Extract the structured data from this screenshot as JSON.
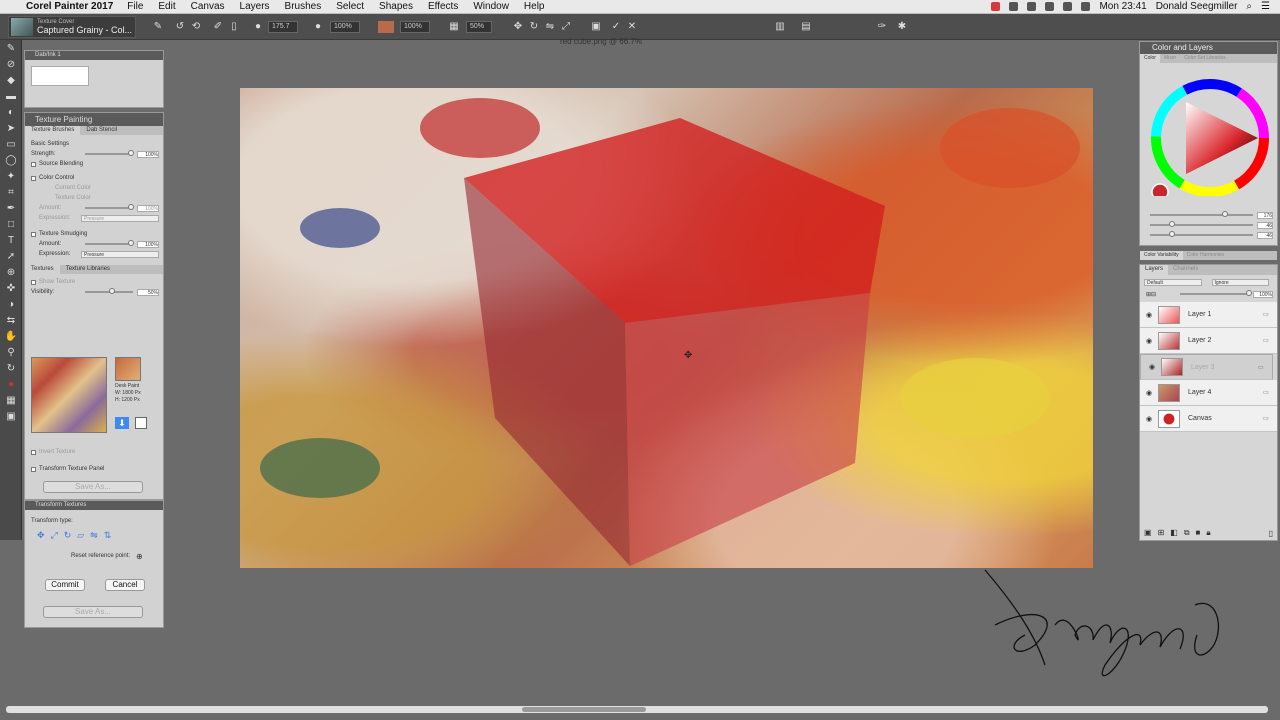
{
  "menubar": {
    "app_name": "Corel Painter 2017",
    "items": [
      "File",
      "Edit",
      "Canvas",
      "Layers",
      "Brushes",
      "Select",
      "Shapes",
      "Effects",
      "Window",
      "Help"
    ],
    "clock": "Mon 23:41",
    "user": "Donald Seegmiller"
  },
  "propbar": {
    "brush_category": "Texture Cover",
    "brush_variant": "Captured Grainy - Col...",
    "size_value": "175.7",
    "opacity_value": "100%",
    "grain_value": "100%",
    "extra_value": "50%"
  },
  "canvas": {
    "title": "red cube.png @ 66.7%"
  },
  "dab_panel": {
    "title": "Dab/Ink 1"
  },
  "texture_panel": {
    "title": "Texture Painting",
    "tabs": [
      "Texture Brushes",
      "Dab Stencil"
    ],
    "basic_settings": "Basic Settings",
    "strength_label": "Strength:",
    "strength_value": "100%",
    "source_blending": "Source Blending",
    "color_control": "Color Control",
    "current_color": "Current Color",
    "texture_color": "Texture Color",
    "amount_label": "Amount:",
    "amount_value": "100%",
    "expression_label": "Expression:",
    "expression_value": "Pressure",
    "texture_smudging": "Texture Smudging",
    "amount2_value": "100%",
    "expression2_value": "Pressure",
    "textures_tabs": [
      "Textures",
      "Texture Libraries"
    ],
    "show_texture": "Show Texture",
    "visibility_label": "Visibility:",
    "visibility_value": "50%",
    "texture_name": "Desk Paint",
    "texture_w": "W: 1800 Px",
    "texture_h": "H: 1200 Px",
    "invert_texture": "Invert Texture",
    "transform_panel": "Transform Texture Panel",
    "save_as": "Save As..."
  },
  "transform_panel": {
    "title": "Transform Textures",
    "transform_type": "Transform type:",
    "reset_ref": "Reset reference point:",
    "commit": "Commit",
    "cancel": "Cancel",
    "save_as": "Save As..."
  },
  "color_panel": {
    "title": "Color and Layers",
    "tabs": [
      "Color",
      "Mixer",
      "Color Set Libraries"
    ],
    "values": [
      "176",
      "46",
      "46"
    ],
    "variability": "Color Variability",
    "harmonies": "Color Harmonies",
    "current_color": "#c7262c"
  },
  "layers_panel": {
    "tabs": [
      "Layers",
      "Channels"
    ],
    "composite_method": "Default",
    "composite_depth": "Ignore",
    "opacity": "100%",
    "layers": [
      {
        "name": "Layer 1",
        "selected": false
      },
      {
        "name": "Layer 2",
        "selected": false
      },
      {
        "name": "Layer 3",
        "selected": true
      },
      {
        "name": "Layer 4",
        "selected": false
      },
      {
        "name": "Canvas",
        "selected": false
      }
    ]
  }
}
